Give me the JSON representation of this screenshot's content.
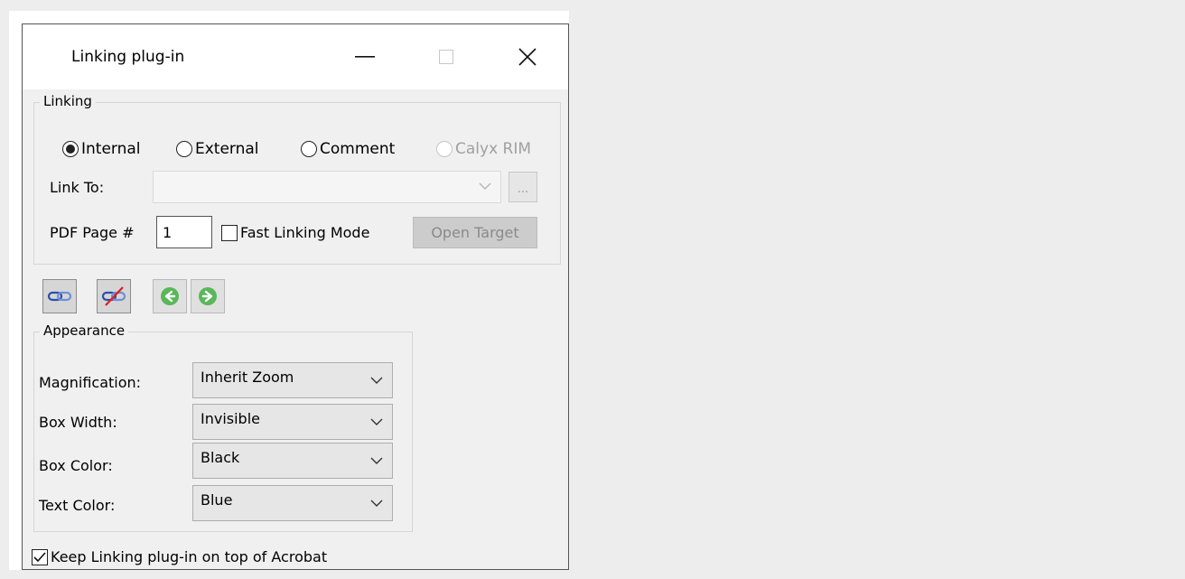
{
  "window": {
    "title": "Linking plug-in"
  },
  "linking": {
    "group_label": "Linking",
    "radios": {
      "internal": "Internal",
      "external": "External",
      "comment": "Comment",
      "calyx": "Calyx RIM"
    },
    "selected": "internal",
    "link_to_label": "Link To:",
    "link_to_value": "",
    "browse_label": "...",
    "pdf_page_label": "PDF Page #",
    "pdf_page_value": "1",
    "fast_linking_label": "Fast Linking Mode",
    "fast_linking_checked": false,
    "open_target_label": "Open Target"
  },
  "toolbar": {
    "icons": [
      "link-icon",
      "unlink-icon",
      "back-arrow-icon",
      "forward-arrow-icon"
    ],
    "nav_color": "#5ab75a",
    "unlink_strike_color": "#e02020"
  },
  "appearance": {
    "group_label": "Appearance",
    "rows": {
      "magnification": {
        "label": "Magnification:",
        "value": "Inherit Zoom"
      },
      "box_width": {
        "label": "Box Width:",
        "value": "Invisible"
      },
      "box_color": {
        "label": "Box Color:",
        "value": "Black"
      },
      "text_color": {
        "label": "Text Color:",
        "value": "Blue"
      }
    }
  },
  "footer": {
    "keep_on_top_label": "Keep Linking plug-in on top of Acrobat",
    "keep_on_top_checked": true
  }
}
